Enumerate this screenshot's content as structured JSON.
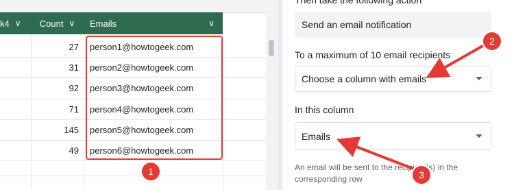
{
  "sheet": {
    "headers": {
      "partial": "k4",
      "count": "Count",
      "emails": "Emails"
    },
    "rows": [
      {
        "count": "27",
        "email": "person1@howtogeek.com"
      },
      {
        "count": "31",
        "email": "person2@howtogeek.com"
      },
      {
        "count": "92",
        "email": "person3@howtogeek.com"
      },
      {
        "count": "71",
        "email": "person4@howtogeek.com"
      },
      {
        "count": "145",
        "email": "person5@howtogeek.com"
      },
      {
        "count": "49",
        "email": "person6@howtogeek.com"
      }
    ]
  },
  "panel": {
    "action_label": "Then take the following action",
    "action_value": "Send an email notification",
    "recipients_label": "To a maximum of 10 email recipients",
    "recipients_select": "Choose a column with emails",
    "column_label": "In this column",
    "column_select": "Emails",
    "note": "An email will be sent to the recipient(s) in the corresponding row"
  },
  "annotations": {
    "badge1": "1",
    "badge2": "2",
    "badge3": "3",
    "color": "#e53935"
  },
  "icons": {
    "header_dropdown": "chevron-down-icon",
    "select_dropdown": "caret-down-icon"
  },
  "colors": {
    "header_bg": "#2e6b4f",
    "header_text": "#ffffff",
    "grid_line": "#e2e3e3",
    "annotation": "#e53935"
  }
}
